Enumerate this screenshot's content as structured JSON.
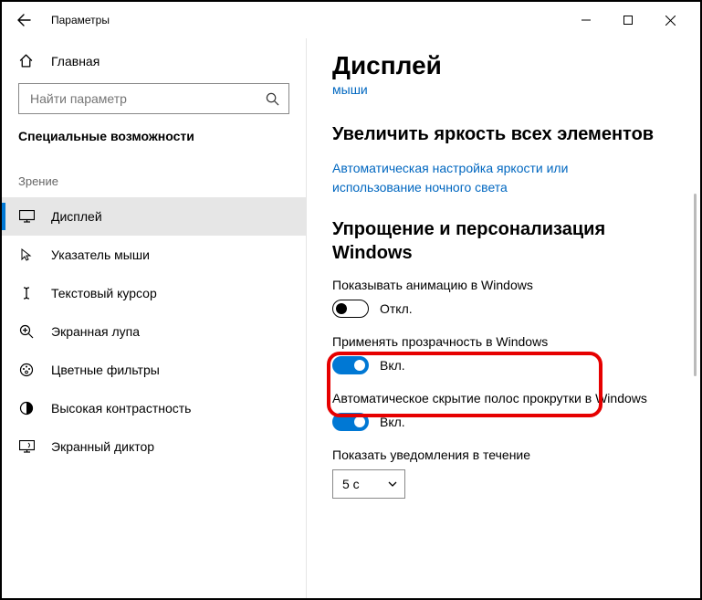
{
  "titlebar": {
    "title": "Параметры"
  },
  "sidebar": {
    "home_label": "Главная",
    "search_placeholder": "Найти параметр",
    "category": "Специальные возможности",
    "group": "Зрение",
    "items": [
      {
        "label": "Дисплей"
      },
      {
        "label": "Указатель мыши"
      },
      {
        "label": "Текстовый курсор"
      },
      {
        "label": "Экранная лупа"
      },
      {
        "label": "Цветные фильтры"
      },
      {
        "label": "Высокая контрастность"
      },
      {
        "label": "Экранный диктор"
      }
    ]
  },
  "main": {
    "page_title": "Дисплей",
    "tiny_link": "мыши",
    "section1_title": "Увеличить яркость всех элементов",
    "brightness_link": "Автоматическая настройка яркости или использование ночного света",
    "section2_title": "Упрощение и персонализация Windows",
    "anim_label": "Показывать анимацию в Windows",
    "anim_state": "Откл.",
    "trans_label": "Применять прозрачность в Windows",
    "trans_state": "Вкл.",
    "scroll_label": "Автоматическое скрытие полос прокрутки в Windows",
    "scroll_state": "Вкл.",
    "notif_label": "Показать уведомления в течение",
    "notif_value": "5 с"
  }
}
